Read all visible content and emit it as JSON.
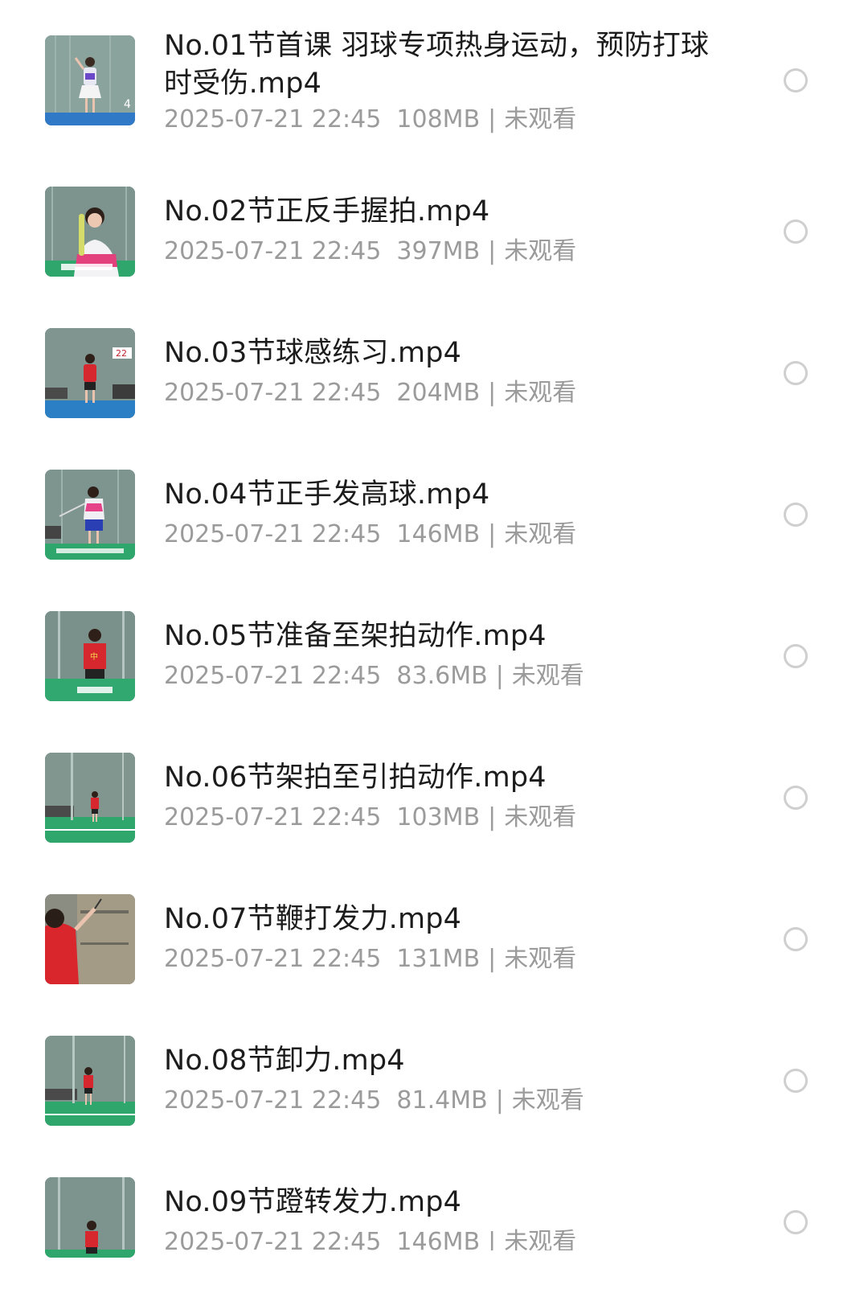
{
  "files": [
    {
      "name": "No.01节首课  羽球专项热身运动，预防打球时受伤.mp4",
      "date": "2025-07-21 22:45",
      "size": "108MB",
      "status": "未观看",
      "thumb": "white-dress-player-icon"
    },
    {
      "name": "No.02节正反手握拍.mp4",
      "date": "2025-07-21 22:45",
      "size": "397MB",
      "status": "未观看",
      "thumb": "grip-closeup-icon"
    },
    {
      "name": "No.03节球感练习.mp4",
      "date": "2025-07-21 22:45",
      "size": "204MB",
      "status": "未观看",
      "thumb": "red-shirt-player-icon"
    },
    {
      "name": "No.04节正手发高球.mp4",
      "date": "2025-07-21 22:45",
      "size": "146MB",
      "status": "未观看",
      "thumb": "serve-player-icon"
    },
    {
      "name": "No.05节准备至架拍动作.mp4",
      "date": "2025-07-21 22:45",
      "size": "83.6MB",
      "status": "未观看",
      "thumb": "red-shirt-player-icon"
    },
    {
      "name": "No.06节架拍至引拍动作.mp4",
      "date": "2025-07-21 22:45",
      "size": "103MB",
      "status": "未观看",
      "thumb": "court-wide-player-icon"
    },
    {
      "name": "No.07节鞭打发力.mp4",
      "date": "2025-07-21 22:45",
      "size": "131MB",
      "status": "未观看",
      "thumb": "swing-closeup-icon"
    },
    {
      "name": "No.08节卸力.mp4",
      "date": "2025-07-21 22:45",
      "size": "81.4MB",
      "status": "未观看",
      "thumb": "court-wide-player-icon"
    },
    {
      "name": "No.09节蹬转发力.mp4",
      "date": "2025-07-21 22:45",
      "size": "146MB",
      "status": "未观看",
      "thumb": "red-shirt-player-icon"
    }
  ],
  "meta_separator": "|"
}
